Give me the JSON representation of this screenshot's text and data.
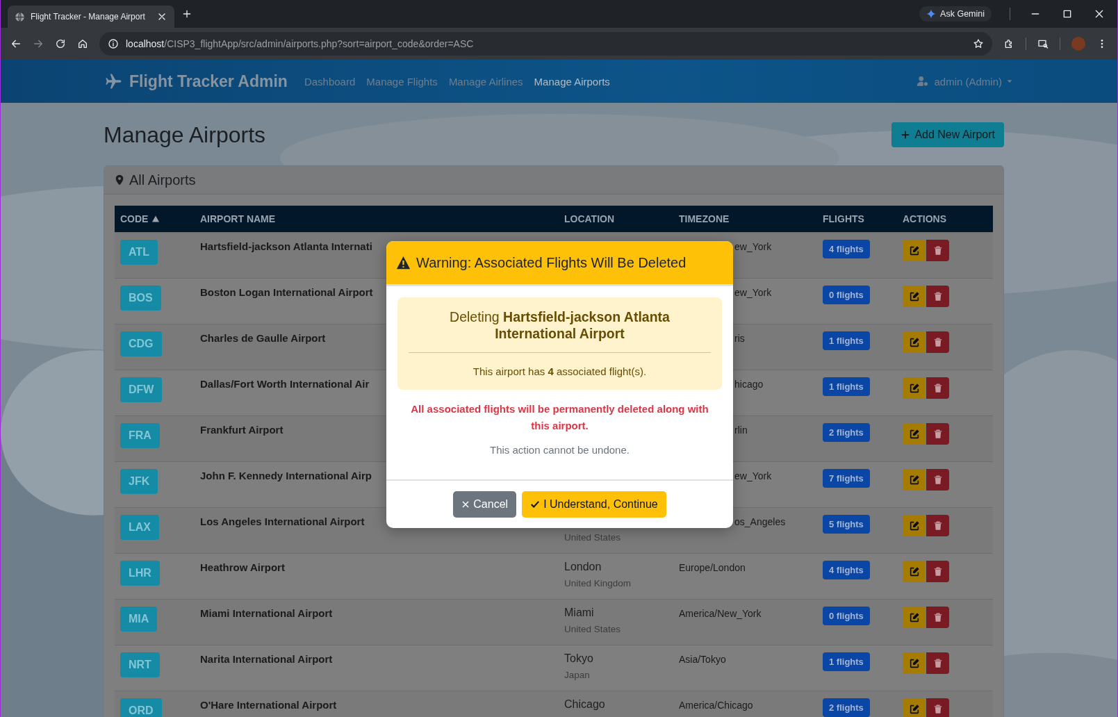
{
  "browser": {
    "tab_title": "Flight Tracker - Manage Airport",
    "url_host": "localhost",
    "url_path": "/CISP3_flightApp/src/admin/airports.php?sort=airport_code&order=ASC",
    "assistant": "Ask Gemini"
  },
  "navbar": {
    "brand": "Flight Tracker Admin",
    "links": [
      {
        "label": "Dashboard",
        "selected": false
      },
      {
        "label": "Manage Flights",
        "selected": false
      },
      {
        "label": "Manage Airlines",
        "selected": false
      },
      {
        "label": "Manage Airports",
        "selected": true
      }
    ],
    "user": "admin (Admin)"
  },
  "page": {
    "title": "Manage Airports",
    "add_button": "Add New Airport"
  },
  "card": {
    "title": "All Airports"
  },
  "table": {
    "columns": [
      {
        "label": "CODE",
        "sorted": true
      },
      {
        "label": "AIRPORT NAME",
        "sorted": false
      },
      {
        "label": "LOCATION",
        "sorted": false
      },
      {
        "label": "TIMEZONE",
        "sorted": false
      },
      {
        "label": "FLIGHTS",
        "sorted": false
      },
      {
        "label": "ACTIONS",
        "sorted": false
      }
    ],
    "rows": [
      {
        "code": "ATL",
        "name": "Hartsfield-jackson Atlanta Internati",
        "timezone": "ew_York",
        "flights": "4 flights"
      },
      {
        "code": "BOS",
        "name": "Boston Logan International Airport",
        "timezone": "ew_York",
        "flights": "0 flights"
      },
      {
        "code": "CDG",
        "name": "Charles de Gaulle Airport",
        "timezone": "ris",
        "flights": "1 flights"
      },
      {
        "code": "DFW",
        "name": "Dallas/Fort Worth International Air",
        "timezone": "hicago",
        "flights": "1 flights"
      },
      {
        "code": "FRA",
        "name": "Frankfurt Airport",
        "timezone": "rlin",
        "flights": "2 flights"
      },
      {
        "code": "JFK",
        "name": "John F. Kennedy International Airp",
        "timezone": "ew_York",
        "flights": "7 flights"
      },
      {
        "code": "LAX",
        "name": "Los Angeles International Airport",
        "country": "United States",
        "timezone": "os_Angeles",
        "flights": "5 flights"
      },
      {
        "code": "LHR",
        "name": "Heathrow Airport",
        "city": "London",
        "country": "United Kingdom",
        "timezone": "Europe/London",
        "flights": "4 flights"
      },
      {
        "code": "MIA",
        "name": "Miami International Airport",
        "city": "Miami",
        "country": "United States",
        "timezone": "America/New_York",
        "flights": "0 flights"
      },
      {
        "code": "NRT",
        "name": "Narita International Airport",
        "city": "Tokyo",
        "country": "Japan",
        "timezone": "Asia/Tokyo",
        "flights": "1 flights"
      },
      {
        "code": "ORD",
        "name": "O'Hare International Airport",
        "city": "Chicago",
        "timezone": "America/Chicago",
        "flights": "2 flights"
      }
    ]
  },
  "modal": {
    "title": "Warning: Associated Flights Will Be Deleted",
    "heading": "Deleting **Hartsfield-jackson Atlanta International Airport**",
    "count_text": "This airport has **4** associated flight(s).",
    "danger": "All associated flights will be permanently deleted along with this airport.",
    "note": "This action cannot be undone.",
    "buttons": [
      {
        "label": "Cancel",
        "kind": "cancel"
      },
      {
        "label": "I Understand, Continue",
        "kind": "confirm"
      }
    ]
  }
}
